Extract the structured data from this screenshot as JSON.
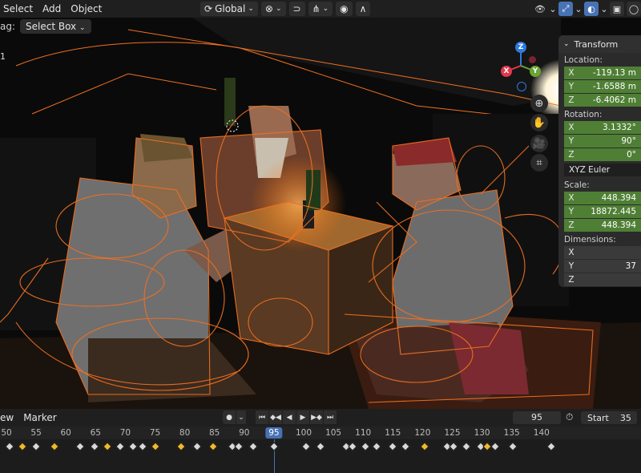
{
  "header": {
    "menus": [
      "Select",
      "Add",
      "Object"
    ],
    "transform_orientation": "Global"
  },
  "subheader": {
    "drag_label": "ag:",
    "select_mode": "Select Box"
  },
  "viewport": {
    "corner_number": "1"
  },
  "gizmo": {
    "z_label": "Z",
    "x_label": "X",
    "y_label": "Y"
  },
  "colors": {
    "accent": "#4772b3",
    "selected_outline": "#f07020",
    "green_field": "#4f7f35",
    "panel_bg": "#2b2b2b",
    "x_axis": "#e2384d",
    "y_axis": "#6aa533",
    "z_axis": "#2d7ae0"
  },
  "npanel": {
    "title": "Transform",
    "location": {
      "label": "Location:",
      "rows": [
        {
          "axis": "X",
          "value": "-119.13 m"
        },
        {
          "axis": "Y",
          "value": "-1.6588 m"
        },
        {
          "axis": "Z",
          "value": "-6.4062 m"
        }
      ]
    },
    "rotation": {
      "label": "Rotation:",
      "rows": [
        {
          "axis": "X",
          "value": "3.1332°"
        },
        {
          "axis": "Y",
          "value": "90°"
        },
        {
          "axis": "Z",
          "value": "0°"
        }
      ],
      "mode": "XYZ Euler"
    },
    "scale": {
      "label": "Scale:",
      "rows": [
        {
          "axis": "X",
          "value": "448.394"
        },
        {
          "axis": "Y",
          "value": "18872.445"
        },
        {
          "axis": "Z",
          "value": "448.394"
        }
      ]
    },
    "dimensions": {
      "label": "Dimensions:",
      "rows": [
        {
          "axis": "X",
          "value": ""
        },
        {
          "axis": "Y",
          "value": "37"
        },
        {
          "axis": "Z",
          "value": ""
        }
      ]
    }
  },
  "timeline": {
    "menus": [
      "ew",
      "Marker"
    ],
    "current_frame": "95",
    "start_label": "Start",
    "start_value": "35",
    "ticks": [
      "50",
      "55",
      "60",
      "65",
      "70",
      "75",
      "80",
      "85",
      "90",
      "95",
      "100",
      "105",
      "110",
      "115",
      "120",
      "125",
      "130",
      "135",
      "140"
    ],
    "playhead": "95"
  }
}
